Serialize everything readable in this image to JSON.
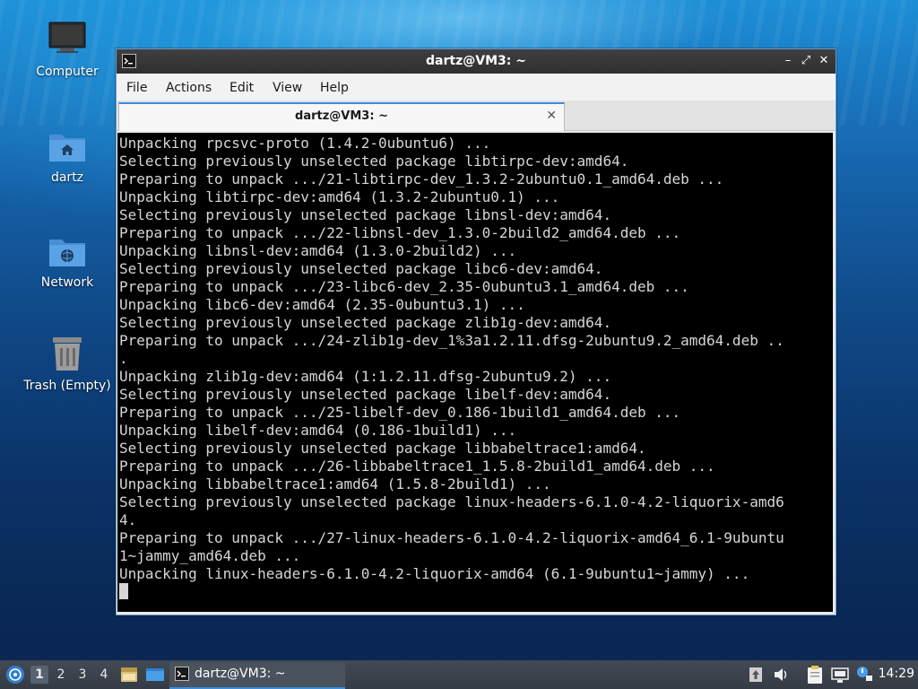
{
  "desktop": {
    "icons": [
      {
        "label": "Computer",
        "icon": "monitor-icon"
      },
      {
        "label": "dartz",
        "icon": "home-folder-icon"
      },
      {
        "label": "Network",
        "icon": "network-folder-icon"
      },
      {
        "label": "Trash (Empty)",
        "icon": "trash-icon"
      }
    ]
  },
  "window": {
    "title": "dartz@VM3: ~",
    "app_icon": "terminal-icon",
    "controls": {
      "minimize": "–",
      "maximize": "⤢",
      "close": "✕"
    },
    "menu": [
      "File",
      "Actions",
      "Edit",
      "View",
      "Help"
    ],
    "tab": {
      "label": "dartz@VM3: ~",
      "close": "✕"
    },
    "terminal_lines": [
      "Unpacking rpcsvc-proto (1.4.2-0ubuntu6) ...",
      "Selecting previously unselected package libtirpc-dev:amd64.",
      "Preparing to unpack .../21-libtirpc-dev_1.3.2-2ubuntu0.1_amd64.deb ...",
      "Unpacking libtirpc-dev:amd64 (1.3.2-2ubuntu0.1) ...",
      "Selecting previously unselected package libnsl-dev:amd64.",
      "Preparing to unpack .../22-libnsl-dev_1.3.0-2build2_amd64.deb ...",
      "Unpacking libnsl-dev:amd64 (1.3.0-2build2) ...",
      "Selecting previously unselected package libc6-dev:amd64.",
      "Preparing to unpack .../23-libc6-dev_2.35-0ubuntu3.1_amd64.deb ...",
      "Unpacking libc6-dev:amd64 (2.35-0ubuntu3.1) ...",
      "Selecting previously unselected package zlib1g-dev:amd64.",
      "Preparing to unpack .../24-zlib1g-dev_1%3a1.2.11.dfsg-2ubuntu9.2_amd64.deb ..",
      ".",
      "Unpacking zlib1g-dev:amd64 (1:1.2.11.dfsg-2ubuntu9.2) ...",
      "Selecting previously unselected package libelf-dev:amd64.",
      "Preparing to unpack .../25-libelf-dev_0.186-1build1_amd64.deb ...",
      "Unpacking libelf-dev:amd64 (0.186-1build1) ...",
      "Selecting previously unselected package libbabeltrace1:amd64.",
      "Preparing to unpack .../26-libbabeltrace1_1.5.8-2build1_amd64.deb ...",
      "Unpacking libbabeltrace1:amd64 (1.5.8-2build1) ...",
      "Selecting previously unselected package linux-headers-6.1.0-4.2-liquorix-amd6",
      "4.",
      "Preparing to unpack .../27-linux-headers-6.1.0-4.2-liquorix-amd64_6.1-9ubuntu",
      "1~jammy_amd64.deb ...",
      "Unpacking linux-headers-6.1.0-4.2-liquorix-amd64 (6.1-9ubuntu1~jammy) ..."
    ]
  },
  "taskbar": {
    "start_icon": "lubuntu-start-icon",
    "workspaces": [
      "1",
      "2",
      "3",
      "4"
    ],
    "active_workspace": "1",
    "quicklaunch": [
      "file-manager-icon",
      "show-desktop-icon"
    ],
    "task": {
      "label": "dartz@VM3: ~",
      "icon": "terminal-icon"
    },
    "tray": [
      "update-notifier-icon",
      "volume-icon",
      "clipboard-icon",
      "network-icon",
      "notification-icon"
    ],
    "clock": "14:29"
  }
}
